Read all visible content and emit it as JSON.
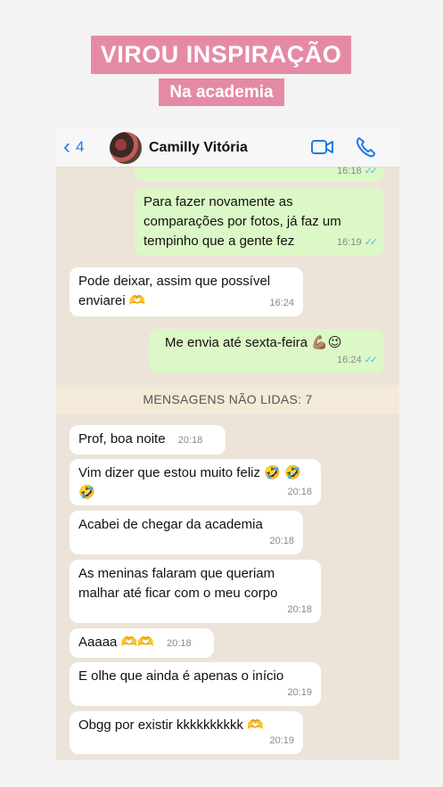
{
  "banner": {
    "title": "VIROU INSPIRAÇÃO",
    "subtitle": "Na academia"
  },
  "header": {
    "back_count": "4",
    "contact_name": "Camilly Vitória"
  },
  "messages": [
    {
      "dir": "out",
      "text": "",
      "time": "16:18",
      "read": true
    },
    {
      "dir": "out",
      "text": "Para fazer novamente as comparações por fotos, já faz um tempinho que a gente fez",
      "time": "16:19",
      "read": true
    },
    {
      "dir": "in",
      "text": "Pode deixar, assim que possível enviarei 🫶",
      "time": "16:24"
    },
    {
      "dir": "out",
      "text": "Me envia até sexta-feira 💪🏽😉",
      "time": "16:24",
      "read": true
    },
    {
      "dir": "in",
      "text": "Prof, boa noite",
      "time": "20:18"
    },
    {
      "dir": "in",
      "text": "Vim dizer que estou muito feliz 🤣 🤣🤣",
      "time": "20:18"
    },
    {
      "dir": "in",
      "text": "Acabei de chegar da academia",
      "time": "20:18"
    },
    {
      "dir": "in",
      "text": "As meninas falaram que queriam malhar até ficar com o meu corpo",
      "time": "20:18"
    },
    {
      "dir": "in",
      "text": "Aaaaa 🫶🫶",
      "time": "20:18"
    },
    {
      "dir": "in",
      "text": "E olhe que ainda é apenas o início",
      "time": "20:19"
    },
    {
      "dir": "in",
      "text": "Obgg por existir kkkkkkkkkk 🫶",
      "time": "20:19"
    }
  ],
  "unread": {
    "label": "MENSAGENS NÃO LIDAS: 7"
  },
  "icons": {
    "back": "chevron-left-icon",
    "video": "video-call-icon",
    "call": "phone-call-icon",
    "read": "double-check-icon"
  },
  "colors": {
    "accent": "#e58aa5",
    "outgoing": "#dcf8c6",
    "incoming": "#ffffff",
    "link": "#1f7ae0",
    "read_ticks": "#4fb6ec"
  }
}
